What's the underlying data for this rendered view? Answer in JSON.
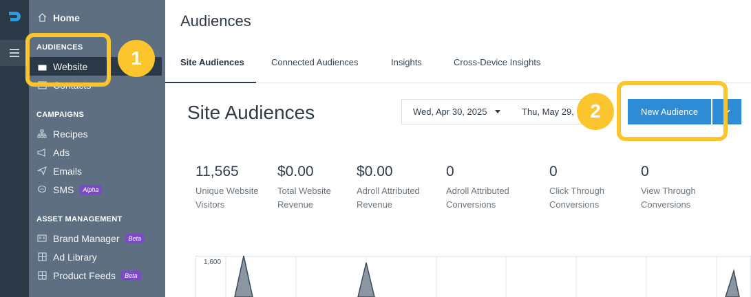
{
  "sidebar": {
    "home": "Home",
    "sections": [
      {
        "title": "AUDIENCES",
        "items": [
          {
            "label": "Website"
          },
          {
            "label": "Contacts"
          }
        ]
      },
      {
        "title": "CAMPAIGNS",
        "items": [
          {
            "label": "Recipes"
          },
          {
            "label": "Ads"
          },
          {
            "label": "Emails"
          },
          {
            "label": "SMS",
            "badge": "Alpha"
          }
        ]
      },
      {
        "title": "ASSET MANAGEMENT",
        "items": [
          {
            "label": "Brand Manager",
            "badge": "Beta"
          },
          {
            "label": "Ad Library"
          },
          {
            "label": "Product Feeds",
            "badge": "Beta"
          }
        ]
      }
    ]
  },
  "header": {
    "title": "Audiences"
  },
  "tabs": [
    {
      "label": "Site Audiences"
    },
    {
      "label": "Connected Audiences"
    },
    {
      "label": "Insights"
    },
    {
      "label": "Cross-Device Insights"
    }
  ],
  "main": {
    "title": "Site Audiences",
    "start_date": "Wed, Apr 30, 2025",
    "end_date": "Thu, May 29,",
    "new_audience": "New Audience"
  },
  "stats": [
    {
      "value": "11,565",
      "label1": "Unique Website",
      "label2": "Visitors"
    },
    {
      "value": "$0.00",
      "label1": "Total Website",
      "label2": "Revenue"
    },
    {
      "value": "$0.00",
      "label1": "Adroll Attributed",
      "label2": "Revenue"
    },
    {
      "value": "0",
      "label1": "Adroll Attributed",
      "label2": "Conversions"
    },
    {
      "value": "0",
      "label1": "Click Through",
      "label2": "Conversions"
    },
    {
      "value": "0",
      "label1": "View Through",
      "label2": "Conversions"
    }
  ],
  "callouts": [
    "1",
    "2"
  ],
  "chart_data": {
    "type": "area",
    "y_ticks": [
      "1,600"
    ],
    "color": "#7c8a96"
  },
  "colors": {
    "accent": "#2e8bd6",
    "highlight": "#fcc52d",
    "sidebar": "#5d6f80",
    "rail": "#2b3947"
  }
}
